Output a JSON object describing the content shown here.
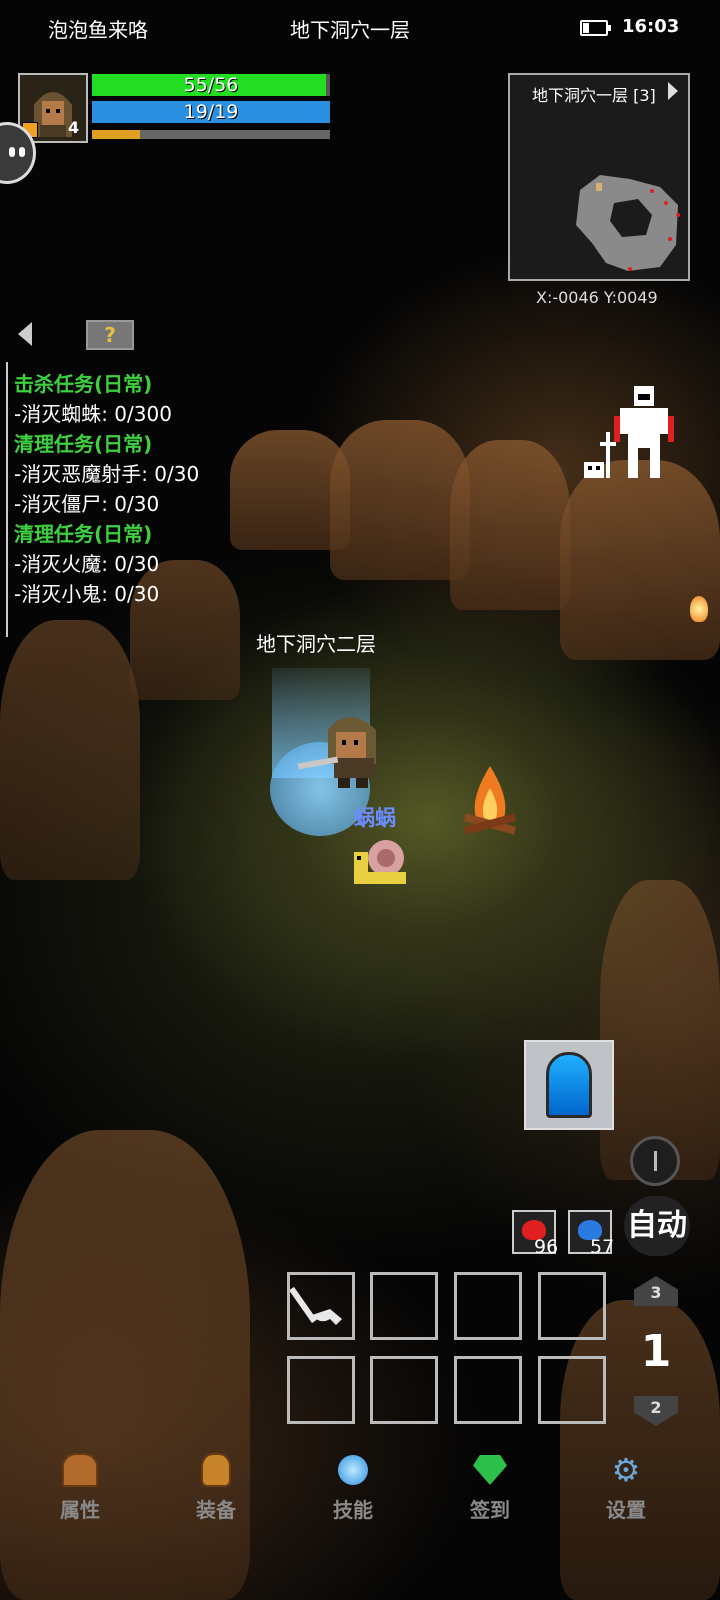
{
  "status_bar": {
    "app_name": "泡泡鱼来咯",
    "location": "地下洞穴一层",
    "time": "16:03"
  },
  "player": {
    "level": "4",
    "hp_text": "55/56",
    "hp_fraction": 0.982,
    "mp_text": "19/19",
    "mp_fraction": 1.0,
    "xp_fraction": 0.2
  },
  "minimap": {
    "title": "地下洞穴一层 [3]",
    "coords": "X:-0046  Y:0049"
  },
  "quests": [
    {
      "heading": "击杀任务(日常)",
      "items": [
        "-消灭蜘蛛: 0/300"
      ]
    },
    {
      "heading": "清理任务(日常)",
      "items": [
        "-消灭恶魔射手: 0/30",
        "-消灭僵尸: 0/30"
      ]
    },
    {
      "heading": "清理任务(日常)",
      "items": [
        "-消灭火魔: 0/30",
        "-消灭小鬼: 0/30"
      ]
    }
  ],
  "world": {
    "portal_label": "地下洞穴二层",
    "enemy_name": "蜗蜗"
  },
  "potions": {
    "hp_count": "96",
    "mp_count": "57"
  },
  "auto_label": "自动",
  "floor": {
    "up": "3",
    "current": "1",
    "down": "2"
  },
  "nav": [
    {
      "label": "属性",
      "icon": "helmet-icon"
    },
    {
      "label": "装备",
      "icon": "bag-icon"
    },
    {
      "label": "技能",
      "icon": "skill-orb-icon"
    },
    {
      "label": "签到",
      "icon": "gem-icon"
    },
    {
      "label": "设置",
      "icon": "gear-icon"
    }
  ],
  "colors": {
    "hp": "#22dd22",
    "mp": "#2a8fe0",
    "xp": "#e0a020",
    "quest_heading": "#3fd03f",
    "enemy_name": "#6a8cff",
    "background": "#050505"
  }
}
